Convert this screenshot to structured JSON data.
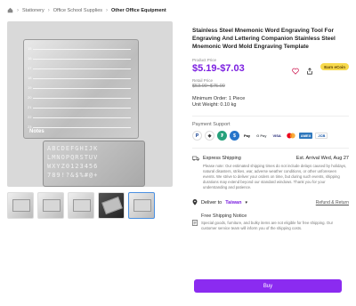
{
  "breadcrumb": {
    "items": [
      "Stationery",
      "Office School Supplies",
      "Other Office Equipment"
    ]
  },
  "gallery": {
    "plate_numbers": [
      "15",
      "16",
      "17",
      "18",
      "19",
      "20",
      "21",
      "22",
      "23"
    ],
    "plate_label": "Notes",
    "stencil_rows": [
      "ABCDEFGHIJK",
      "LMNOPQRSTUV",
      "WXYZ0123456",
      "789!?&$%#@+"
    ],
    "thumbnail_count": 5,
    "active_thumbnail": 5
  },
  "product": {
    "title": "Stainless Steel Mnemonic Word Engraving Tool For Engraving And Lettering Companion Stainless Steel Mnemonic Word Mold Engraving Template",
    "price_label": "Product Price",
    "price": "$5.19-$7.03",
    "retail_label": "Retail Price",
    "retail_price": "$53.00~$75.00",
    "earn_badge": "Earn eCoin",
    "min_order": "Minimum Order: 1 Piece",
    "unit_weight": "Unit Weight: 0.10 kg"
  },
  "payment": {
    "title": "Payment Support",
    "methods": [
      "paypal",
      "ethereum",
      "tether",
      "usdc",
      "apple-pay",
      "google-pay",
      "visa",
      "mastercard",
      "amex",
      "jcb"
    ],
    "labels": {
      "apple_pay": "Pay",
      "google_pay": "G Pay",
      "visa": "VISA",
      "amex": "AMEX",
      "jcb": "JCB"
    }
  },
  "shipping": {
    "method": "Express Shipping",
    "arrival": "Est. Arrival Wed, Aug 27",
    "description": "Please note: Our estimated shipping times do not include delays caused by holidays, natural disasters, strikes, war, adverse weather conditions, or other unforeseen events. We strive to deliver your orders on time, but during such events, shipping durations may extend beyond our standard windows. Thank you for your understanding and patience.",
    "deliver_label": "Deliver to",
    "country": "Taiwan",
    "refund_link": "Refund & Return"
  },
  "notes": {
    "title": "Free Shipping Notice",
    "description": "Special goods, furniture, and bulky items are not eligible for free shipping. Our customer service team will inform you of the shipping costs."
  },
  "buy_label": "Buy",
  "colors": {
    "accent": "#7b1fe0",
    "buy_button": "#8b2bf0",
    "badge": "#f7d94c"
  }
}
